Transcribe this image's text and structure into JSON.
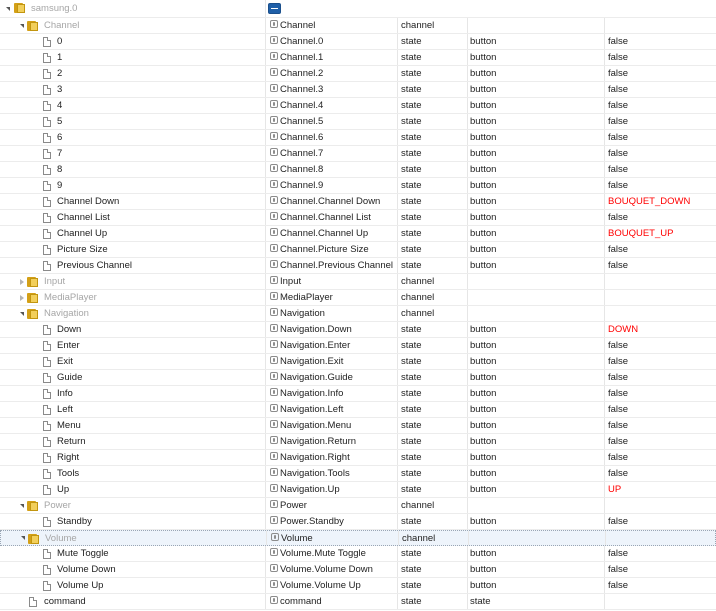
{
  "tree": {
    "root_label": "samsung.0",
    "rows": [
      {
        "level": 1,
        "kind": "folder",
        "expander": "open",
        "name": "Channel",
        "id": "Channel",
        "type": "channel",
        "role": "",
        "value": "",
        "value_red": false,
        "grey": true
      },
      {
        "level": 2,
        "kind": "file",
        "expander": "",
        "name": "0",
        "id": "Channel.0",
        "type": "state",
        "role": "button",
        "value": "false",
        "value_red": false,
        "grey": false
      },
      {
        "level": 2,
        "kind": "file",
        "expander": "",
        "name": "1",
        "id": "Channel.1",
        "type": "state",
        "role": "button",
        "value": "false",
        "value_red": false,
        "grey": false
      },
      {
        "level": 2,
        "kind": "file",
        "expander": "",
        "name": "2",
        "id": "Channel.2",
        "type": "state",
        "role": "button",
        "value": "false",
        "value_red": false,
        "grey": false
      },
      {
        "level": 2,
        "kind": "file",
        "expander": "",
        "name": "3",
        "id": "Channel.3",
        "type": "state",
        "role": "button",
        "value": "false",
        "value_red": false,
        "grey": false
      },
      {
        "level": 2,
        "kind": "file",
        "expander": "",
        "name": "4",
        "id": "Channel.4",
        "type": "state",
        "role": "button",
        "value": "false",
        "value_red": false,
        "grey": false
      },
      {
        "level": 2,
        "kind": "file",
        "expander": "",
        "name": "5",
        "id": "Channel.5",
        "type": "state",
        "role": "button",
        "value": "false",
        "value_red": false,
        "grey": false
      },
      {
        "level": 2,
        "kind": "file",
        "expander": "",
        "name": "6",
        "id": "Channel.6",
        "type": "state",
        "role": "button",
        "value": "false",
        "value_red": false,
        "grey": false
      },
      {
        "level": 2,
        "kind": "file",
        "expander": "",
        "name": "7",
        "id": "Channel.7",
        "type": "state",
        "role": "button",
        "value": "false",
        "value_red": false,
        "grey": false
      },
      {
        "level": 2,
        "kind": "file",
        "expander": "",
        "name": "8",
        "id": "Channel.8",
        "type": "state",
        "role": "button",
        "value": "false",
        "value_red": false,
        "grey": false
      },
      {
        "level": 2,
        "kind": "file",
        "expander": "",
        "name": "9",
        "id": "Channel.9",
        "type": "state",
        "role": "button",
        "value": "false",
        "value_red": false,
        "grey": false
      },
      {
        "level": 2,
        "kind": "file",
        "expander": "",
        "name": "Channel Down",
        "id": "Channel.Channel Down",
        "type": "state",
        "role": "button",
        "value": "BOUQUET_DOWN",
        "value_red": true,
        "grey": false
      },
      {
        "level": 2,
        "kind": "file",
        "expander": "",
        "name": "Channel List",
        "id": "Channel.Channel List",
        "type": "state",
        "role": "button",
        "value": "false",
        "value_red": false,
        "grey": false
      },
      {
        "level": 2,
        "kind": "file",
        "expander": "",
        "name": "Channel Up",
        "id": "Channel.Channel Up",
        "type": "state",
        "role": "button",
        "value": "BOUQUET_UP",
        "value_red": true,
        "grey": false
      },
      {
        "level": 2,
        "kind": "file",
        "expander": "",
        "name": "Picture Size",
        "id": "Channel.Picture Size",
        "type": "state",
        "role": "button",
        "value": "false",
        "value_red": false,
        "grey": false
      },
      {
        "level": 2,
        "kind": "file",
        "expander": "",
        "name": "Previous Channel",
        "id": "Channel.Previous Channel",
        "type": "state",
        "role": "button",
        "value": "false",
        "value_red": false,
        "grey": false
      },
      {
        "level": 1,
        "kind": "folder",
        "expander": "closed",
        "name": "Input",
        "id": "Input",
        "type": "channel",
        "role": "",
        "value": "",
        "value_red": false,
        "grey": true
      },
      {
        "level": 1,
        "kind": "folder",
        "expander": "closed",
        "name": "MediaPlayer",
        "id": "MediaPlayer",
        "type": "channel",
        "role": "",
        "value": "",
        "value_red": false,
        "grey": true
      },
      {
        "level": 1,
        "kind": "folder",
        "expander": "open",
        "name": "Navigation",
        "id": "Navigation",
        "type": "channel",
        "role": "",
        "value": "",
        "value_red": false,
        "grey": true
      },
      {
        "level": 2,
        "kind": "file",
        "expander": "",
        "name": "Down",
        "id": "Navigation.Down",
        "type": "state",
        "role": "button",
        "value": "DOWN",
        "value_red": true,
        "grey": false
      },
      {
        "level": 2,
        "kind": "file",
        "expander": "",
        "name": "Enter",
        "id": "Navigation.Enter",
        "type": "state",
        "role": "button",
        "value": "false",
        "value_red": false,
        "grey": false
      },
      {
        "level": 2,
        "kind": "file",
        "expander": "",
        "name": "Exit",
        "id": "Navigation.Exit",
        "type": "state",
        "role": "button",
        "value": "false",
        "value_red": false,
        "grey": false
      },
      {
        "level": 2,
        "kind": "file",
        "expander": "",
        "name": "Guide",
        "id": "Navigation.Guide",
        "type": "state",
        "role": "button",
        "value": "false",
        "value_red": false,
        "grey": false
      },
      {
        "level": 2,
        "kind": "file",
        "expander": "",
        "name": "Info",
        "id": "Navigation.Info",
        "type": "state",
        "role": "button",
        "value": "false",
        "value_red": false,
        "grey": false
      },
      {
        "level": 2,
        "kind": "file",
        "expander": "",
        "name": "Left",
        "id": "Navigation.Left",
        "type": "state",
        "role": "button",
        "value": "false",
        "value_red": false,
        "grey": false
      },
      {
        "level": 2,
        "kind": "file",
        "expander": "",
        "name": "Menu",
        "id": "Navigation.Menu",
        "type": "state",
        "role": "button",
        "value": "false",
        "value_red": false,
        "grey": false
      },
      {
        "level": 2,
        "kind": "file",
        "expander": "",
        "name": "Return",
        "id": "Navigation.Return",
        "type": "state",
        "role": "button",
        "value": "false",
        "value_red": false,
        "grey": false
      },
      {
        "level": 2,
        "kind": "file",
        "expander": "",
        "name": "Right",
        "id": "Navigation.Right",
        "type": "state",
        "role": "button",
        "value": "false",
        "value_red": false,
        "grey": false
      },
      {
        "level": 2,
        "kind": "file",
        "expander": "",
        "name": "Tools",
        "id": "Navigation.Tools",
        "type": "state",
        "role": "button",
        "value": "false",
        "value_red": false,
        "grey": false
      },
      {
        "level": 2,
        "kind": "file",
        "expander": "",
        "name": "Up",
        "id": "Navigation.Up",
        "type": "state",
        "role": "button",
        "value": "UP",
        "value_red": true,
        "grey": false
      },
      {
        "level": 1,
        "kind": "folder",
        "expander": "open",
        "name": "Power",
        "id": "Power",
        "type": "channel",
        "role": "",
        "value": "",
        "value_red": false,
        "grey": true
      },
      {
        "level": 2,
        "kind": "file",
        "expander": "",
        "name": "Standby",
        "id": "Power.Standby",
        "type": "state",
        "role": "button",
        "value": "false",
        "value_red": false,
        "grey": false
      },
      {
        "level": 1,
        "kind": "folder",
        "expander": "open",
        "name": "Volume",
        "id": "Volume",
        "type": "channel",
        "role": "",
        "value": "",
        "value_red": false,
        "grey": true,
        "selected": true
      },
      {
        "level": 2,
        "kind": "file",
        "expander": "",
        "name": "Mute Toggle",
        "id": "Volume.Mute Toggle",
        "type": "state",
        "role": "button",
        "value": "false",
        "value_red": false,
        "grey": false
      },
      {
        "level": 2,
        "kind": "file",
        "expander": "",
        "name": "Volume Down",
        "id": "Volume.Volume Down",
        "type": "state",
        "role": "button",
        "value": "false",
        "value_red": false,
        "grey": false
      },
      {
        "level": 2,
        "kind": "file",
        "expander": "",
        "name": "Volume Up",
        "id": "Volume.Volume Up",
        "type": "state",
        "role": "button",
        "value": "false",
        "value_red": false,
        "grey": false
      },
      {
        "level": 1,
        "kind": "file",
        "expander": "",
        "name": "command",
        "id": "command",
        "type": "state",
        "role": "state",
        "value": "",
        "value_red": false,
        "grey": false
      }
    ]
  },
  "colors": {
    "value_red": "#ff0000",
    "toggle_button": "#1f5fa8",
    "folder": "#f2cf5b"
  },
  "icons": {
    "folder": "folder-icon",
    "file": "file-icon",
    "id": "object-id-icon",
    "expand": "chevron-down-icon",
    "collapse": "chevron-right-icon",
    "toggle": "collapse-all-icon"
  }
}
